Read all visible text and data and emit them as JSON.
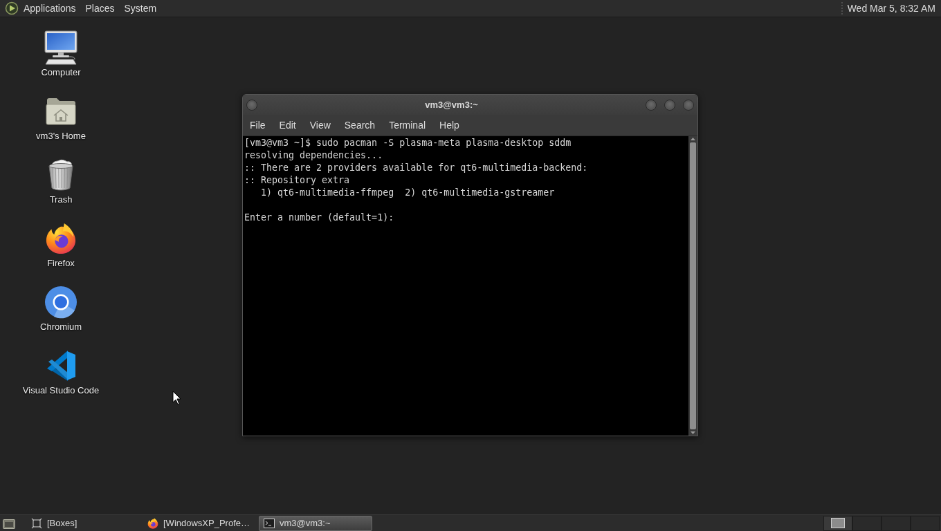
{
  "top_panel": {
    "menus": [
      {
        "label": "Applications"
      },
      {
        "label": "Places"
      },
      {
        "label": "System"
      }
    ],
    "clock": "Wed Mar 5, 8:32 AM"
  },
  "desktop_icons": [
    {
      "kind": "computer",
      "label": "Computer"
    },
    {
      "kind": "home",
      "label": "vm3's Home"
    },
    {
      "kind": "trash",
      "label": "Trash"
    },
    {
      "kind": "firefox",
      "label": "Firefox"
    },
    {
      "kind": "chromium",
      "label": "Chromium"
    },
    {
      "kind": "vscode",
      "label": "Visual Studio Code"
    }
  ],
  "terminal": {
    "title": "vm3@vm3:~",
    "menu": [
      {
        "label": "File"
      },
      {
        "label": "Edit"
      },
      {
        "label": "View"
      },
      {
        "label": "Search"
      },
      {
        "label": "Terminal"
      },
      {
        "label": "Help"
      }
    ],
    "output_blocks": [
      [
        "[vm3@vm3 ~]$ sudo pacman -S plasma-meta plasma-desktop sddm",
        "resolving dependencies...",
        ":: There are 2 providers available for qt6-multimedia-backend:",
        ":: Repository extra",
        "   1) qt6-multimedia-ffmpeg  2) qt6-multimedia-gstreamer"
      ],
      [
        "Enter a number (default=1):"
      ]
    ]
  },
  "taskbar": {
    "tasks": [
      {
        "kind": "boxes",
        "label": "[Boxes]",
        "selected": false
      },
      {
        "kind": "firefox",
        "label": "[WindowsXP_Profe…",
        "selected": false
      },
      {
        "kind": "terminal",
        "label": "vm3@vm3:~",
        "selected": true
      }
    ],
    "workspaces": [
      {
        "selected": true,
        "has_window": true
      },
      {
        "selected": false,
        "has_window": false
      },
      {
        "selected": false,
        "has_window": false
      },
      {
        "selected": false,
        "has_window": false
      }
    ]
  }
}
